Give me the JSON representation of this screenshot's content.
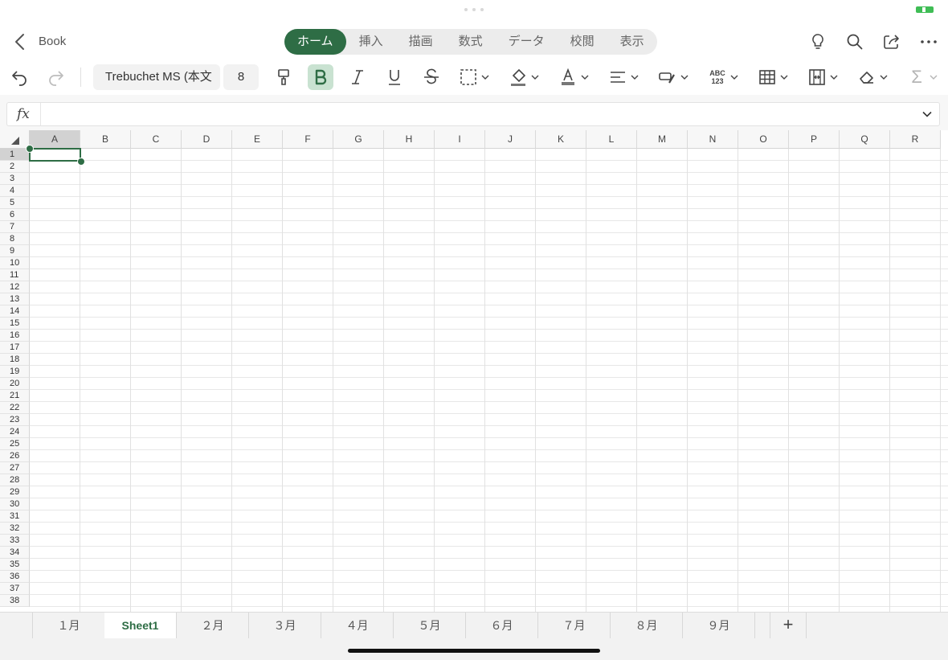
{
  "app": {
    "back_label": "Book",
    "accent_color": "#2e6d45"
  },
  "ribbon": {
    "tabs": [
      {
        "label": "ホーム",
        "active": true
      },
      {
        "label": "挿入",
        "active": false
      },
      {
        "label": "描画",
        "active": false
      },
      {
        "label": "数式",
        "active": false
      },
      {
        "label": "データ",
        "active": false
      },
      {
        "label": "校閲",
        "active": false
      },
      {
        "label": "表示",
        "active": false
      }
    ],
    "right_icons": [
      "lightbulb-icon",
      "search-icon",
      "share-icon",
      "more-icon"
    ]
  },
  "toolbar": {
    "font_name": "Trebuchet MS (本文",
    "font_size": "8",
    "bold_active": true,
    "autosum_label": "Σ",
    "spell_label_top": "ABC",
    "spell_label_bottom": "123"
  },
  "formula_bar": {
    "fx_label": "fx",
    "value": ""
  },
  "sheet": {
    "columns": [
      "A",
      "B",
      "C",
      "D",
      "E",
      "F",
      "G",
      "H",
      "I",
      "J",
      "K",
      "L",
      "M",
      "N",
      "O",
      "P",
      "Q",
      "R"
    ],
    "rows": [
      "1",
      "2",
      "3",
      "4",
      "5",
      "6",
      "7",
      "8",
      "9",
      "10",
      "11",
      "12",
      "13",
      "14",
      "15",
      "16",
      "17",
      "18",
      "19",
      "20",
      "21",
      "22",
      "23",
      "24",
      "25",
      "26",
      "27",
      "28",
      "29",
      "30",
      "31",
      "32",
      "33",
      "34",
      "35",
      "36",
      "37",
      "38"
    ],
    "selected_cell": "A1"
  },
  "sheet_tabs": [
    {
      "label": "１月",
      "active": false
    },
    {
      "label": "Sheet1",
      "active": true
    },
    {
      "label": "２月",
      "active": false
    },
    {
      "label": "３月",
      "active": false
    },
    {
      "label": "４月",
      "active": false
    },
    {
      "label": "５月",
      "active": false
    },
    {
      "label": "６月",
      "active": false
    },
    {
      "label": "７月",
      "active": false
    },
    {
      "label": "８月",
      "active": false
    },
    {
      "label": "９月",
      "active": false
    }
  ],
  "add_sheet_label": "+"
}
